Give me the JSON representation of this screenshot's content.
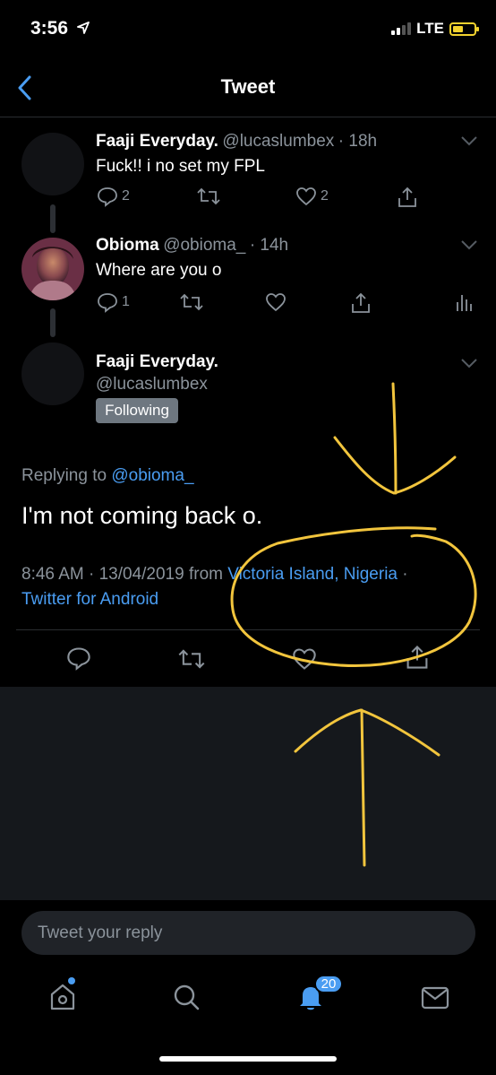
{
  "status_bar": {
    "time": "3:56",
    "network": "LTE"
  },
  "nav": {
    "title": "Tweet"
  },
  "tweets": [
    {
      "name": "Faaji Everyday.",
      "handle": "@lucaslumbex",
      "time": "· 18h",
      "text": "Fuck!! i no set my FPL",
      "reply_count": "2",
      "like_count": "2"
    },
    {
      "name": "Obioma",
      "handle": "@obioma_",
      "time": "· 14h",
      "text": "Where are you o",
      "reply_count": "1"
    }
  ],
  "main_tweet": {
    "name": "Faaji Everyday.",
    "handle": "@lucaslumbex",
    "following_label": "Following",
    "replying_prefix": "Replying to",
    "replying_handle": "@obioma_",
    "text": "I'm not coming back o.",
    "timestamp": "8:46 AM · 13/04/2019 from",
    "location": "Victoria Island, Nigeria",
    "location_sep": " ·",
    "client": "Twitter for Android"
  },
  "reply_box": {
    "placeholder": "Tweet your reply"
  },
  "tab_bar": {
    "notifications_badge": "20"
  },
  "colors": {
    "accent": "#4a9df2",
    "annotation": "#f2c53d"
  }
}
